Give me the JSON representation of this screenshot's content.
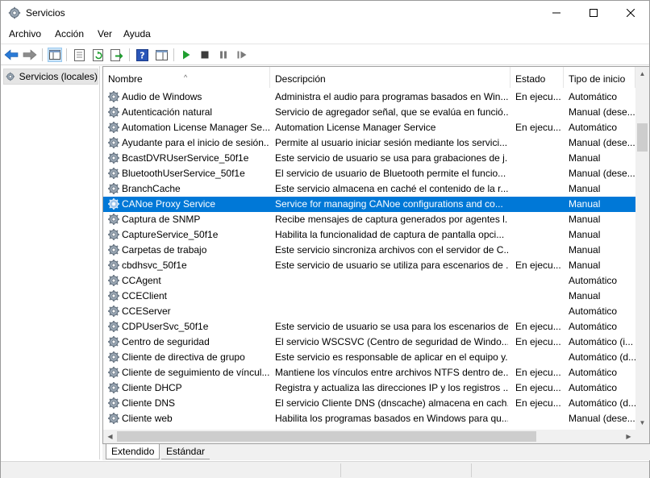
{
  "window": {
    "title": "Servicios",
    "icon": "gear-icon"
  },
  "menu": [
    "Archivo",
    "Acción",
    "Ver",
    "Ayuda"
  ],
  "tree": {
    "label": "Servicios (locales)",
    "icon": "gear-icon"
  },
  "columns": {
    "name": "Nombre",
    "description": "Descripción",
    "state": "Estado",
    "start": "Tipo de inicio"
  },
  "services": [
    {
      "name": "Audio de Windows",
      "desc": "Administra el audio para programas basados en Win...",
      "state": "En ejecu...",
      "start": "Automático"
    },
    {
      "name": "Autenticación natural",
      "desc": "Servicio de agregador señal, que se evalúa en funció...",
      "state": "",
      "start": "Manual (dese..."
    },
    {
      "name": "Automation License Manager Se...",
      "desc": "Automation License Manager Service",
      "state": "En ejecu...",
      "start": "Automático"
    },
    {
      "name": "Ayudante para el inicio de sesión...",
      "desc": "Permite al usuario iniciar sesión mediante los servici...",
      "state": "",
      "start": "Manual (dese..."
    },
    {
      "name": "BcastDVRUserService_50f1e",
      "desc": "Este servicio de usuario se usa para grabaciones de j...",
      "state": "",
      "start": "Manual"
    },
    {
      "name": "BluetoothUserService_50f1e",
      "desc": "El servicio de usuario de Bluetooth permite el funcio...",
      "state": "",
      "start": "Manual (dese..."
    },
    {
      "name": "BranchCache",
      "desc": "Este servicio almacena en caché el contenido de la r...",
      "state": "",
      "start": "Manual"
    },
    {
      "name": "CANoe Proxy Service",
      "desc": "Service for managing CANoe configurations and co...",
      "state": "",
      "start": "Manual",
      "selected": true
    },
    {
      "name": "Captura de SNMP",
      "desc": "Recibe mensajes de captura generados por agentes l...",
      "state": "",
      "start": "Manual"
    },
    {
      "name": "CaptureService_50f1e",
      "desc": "Habilita la funcionalidad de captura de pantalla opci...",
      "state": "",
      "start": "Manual"
    },
    {
      "name": "Carpetas de trabajo",
      "desc": "Este servicio sincroniza archivos con el servidor de C...",
      "state": "",
      "start": "Manual"
    },
    {
      "name": "cbdhsvc_50f1e",
      "desc": "Este servicio de usuario se utiliza para escenarios de ...",
      "state": "En ejecu...",
      "start": "Manual"
    },
    {
      "name": "CCAgent",
      "desc": "",
      "state": "",
      "start": "Automático"
    },
    {
      "name": "CCEClient",
      "desc": "",
      "state": "",
      "start": "Manual"
    },
    {
      "name": "CCEServer",
      "desc": "",
      "state": "",
      "start": "Automático"
    },
    {
      "name": "CDPUserSvc_50f1e",
      "desc": "Este servicio de usuario se usa para los escenarios de...",
      "state": "En ejecu...",
      "start": "Automático"
    },
    {
      "name": "Centro de seguridad",
      "desc": "El servicio WSCSVC (Centro de seguridad de Windo...",
      "state": "En ejecu...",
      "start": "Automático (i..."
    },
    {
      "name": "Cliente de directiva de grupo",
      "desc": "Este servicio es responsable de aplicar en el equipo y...",
      "state": "",
      "start": "Automático (d..."
    },
    {
      "name": "Cliente de seguimiento de víncul...",
      "desc": "Mantiene los vínculos entre archivos NTFS dentro de...",
      "state": "En ejecu...",
      "start": "Automático"
    },
    {
      "name": "Cliente DHCP",
      "desc": "Registra y actualiza las direcciones IP y los registros ...",
      "state": "En ejecu...",
      "start": "Automático"
    },
    {
      "name": "Cliente DNS",
      "desc": "El servicio Cliente DNS (dnscache) almacena en cach...",
      "state": "En ejecu...",
      "start": "Automático (d..."
    },
    {
      "name": "Cliente web",
      "desc": "Habilita los programas basados en Windows para qu...",
      "state": "",
      "start": "Manual (dese..."
    }
  ],
  "tabs": {
    "extended": "Extendido",
    "standard": "Estándar"
  },
  "colors": {
    "selection": "#0078d7",
    "accent_green": "#1f9e2f",
    "nav_blue": "#2a7ad6"
  }
}
